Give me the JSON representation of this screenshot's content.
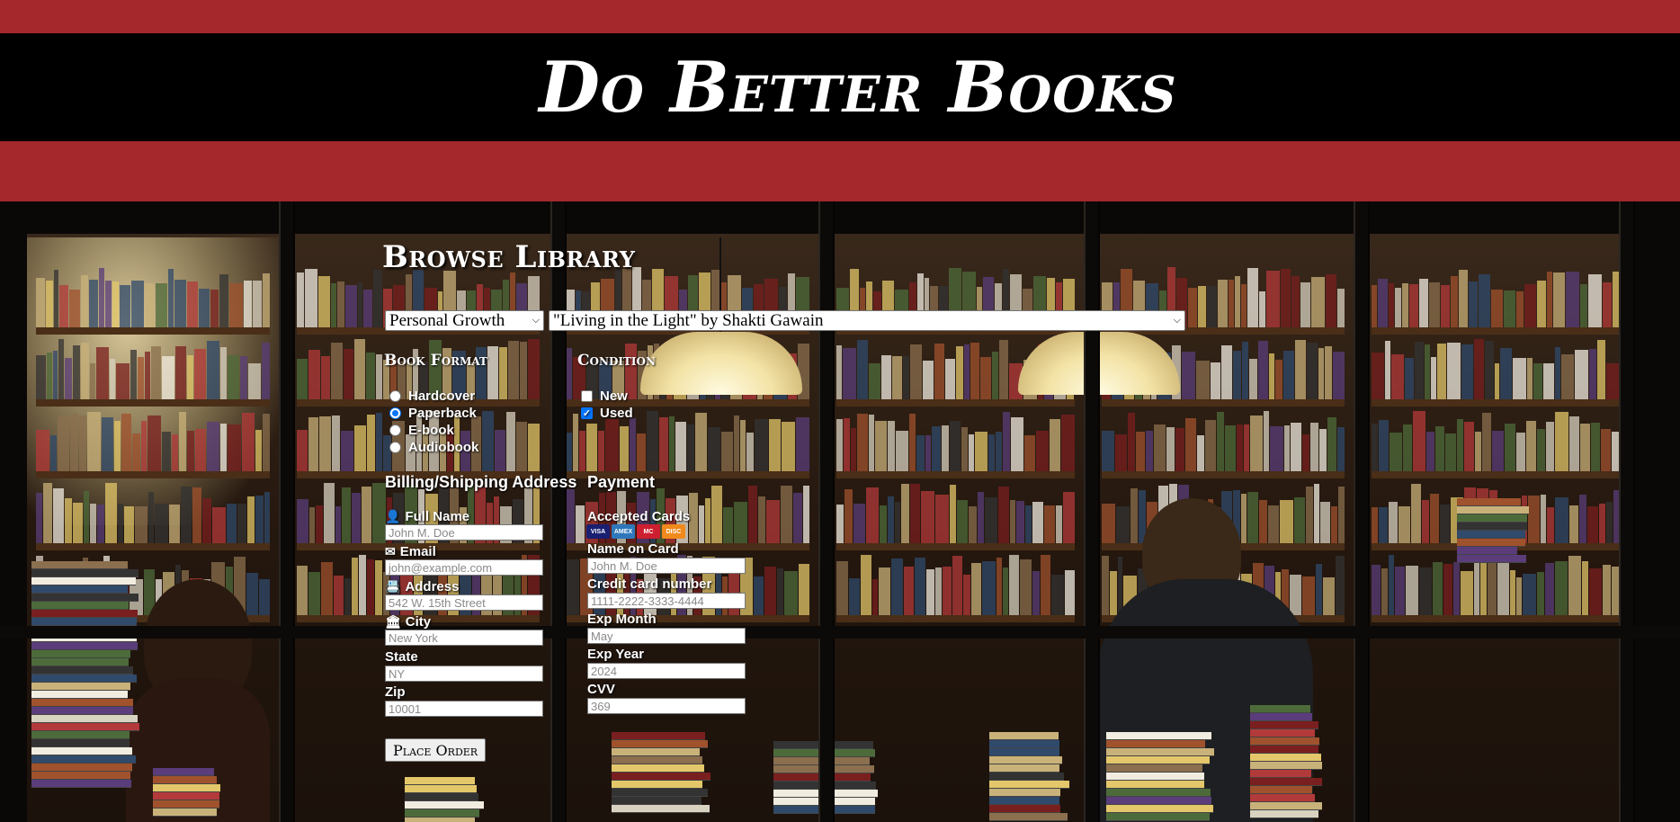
{
  "site": {
    "brand": "Do Better Books"
  },
  "browse": {
    "title": "Browse Library",
    "category": "Personal Growth",
    "book": "\"Living in the Light\" by Shakti Gawain"
  },
  "format": {
    "heading": "Book Format",
    "options": [
      "Hardcover",
      "Paperback",
      "E-book",
      "Audiobook"
    ],
    "selected": "Paperback"
  },
  "condition": {
    "heading": "Condition",
    "options": [
      {
        "label": "New",
        "checked": false
      },
      {
        "label": "Used",
        "checked": true
      }
    ]
  },
  "billing": {
    "heading": "Billing/Shipping Address",
    "fields": {
      "full_name": {
        "label": "Full Name",
        "placeholder": "John M. Doe",
        "icon": "user-icon"
      },
      "email": {
        "label": "Email",
        "placeholder": "john@example.com",
        "icon": "envelope-icon"
      },
      "address": {
        "label": "Address",
        "placeholder": "542 W. 15th Street",
        "icon": "address-card-icon"
      },
      "city": {
        "label": "City",
        "placeholder": "New York",
        "icon": "institution-icon"
      },
      "state": {
        "label": "State",
        "placeholder": "NY"
      },
      "zip": {
        "label": "Zip",
        "placeholder": "10001"
      }
    }
  },
  "payment": {
    "heading": "Payment",
    "accepted_cards_label": "Accepted Cards",
    "cards": [
      {
        "name": "VISA",
        "icon": "visa-card-icon",
        "color": "#1a1f71"
      },
      {
        "name": "AMEX",
        "icon": "amex-card-icon",
        "color": "#2e77bb"
      },
      {
        "name": "MC",
        "icon": "mastercard-icon",
        "color": "#cc1f2f"
      },
      {
        "name": "DISC",
        "icon": "discover-card-icon",
        "color": "#f08a1c"
      }
    ],
    "fields": {
      "name_on_card": {
        "label": "Name on Card",
        "placeholder": "John M. Doe"
      },
      "card_number": {
        "label": "Credit card number",
        "placeholder": "1111-2222-3333-4444"
      },
      "exp_month": {
        "label": "Exp Month",
        "placeholder": "May"
      },
      "exp_year": {
        "label": "Exp Year",
        "placeholder": "2024"
      },
      "cvv": {
        "label": "CVV",
        "placeholder": "369"
      }
    }
  },
  "actions": {
    "place_order": "Place Order"
  },
  "colors": {
    "band": "#a4282c",
    "header": "#000000",
    "accent": "#0075ff"
  }
}
